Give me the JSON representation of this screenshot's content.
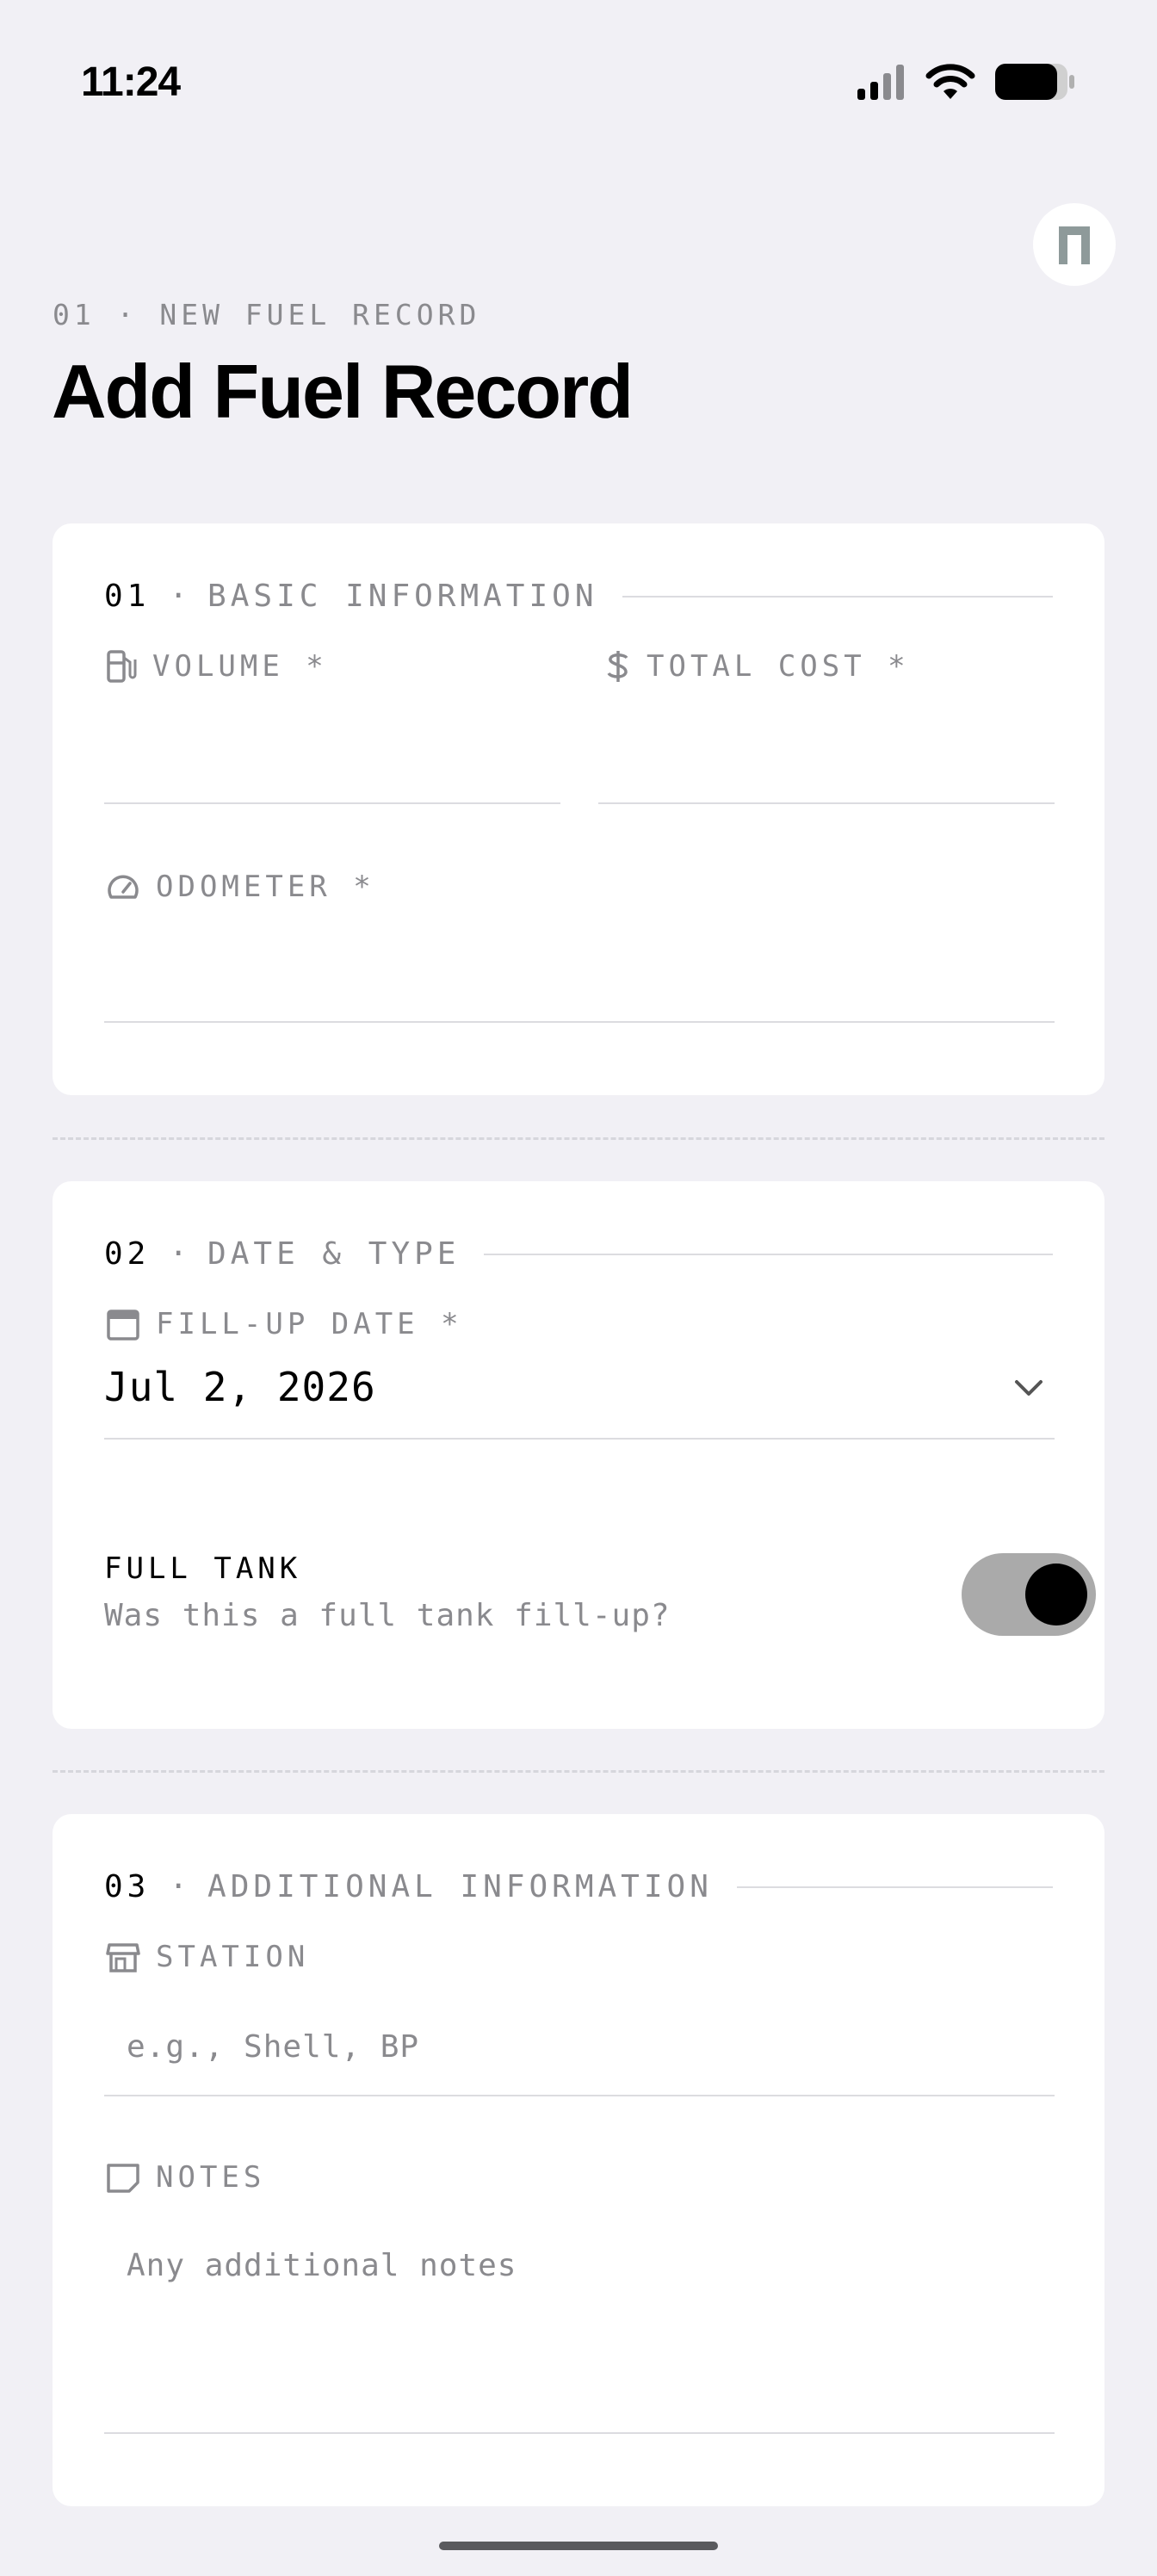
{
  "status_bar": {
    "time": "11:24"
  },
  "avatar": {
    "letter": "n"
  },
  "header": {
    "eyebrow": "01 · NEW FUEL RECORD",
    "title": "Add Fuel Record"
  },
  "section1": {
    "number": "01",
    "title": "BASIC INFORMATION",
    "volume_label": "VOLUME *",
    "total_cost_label": "TOTAL COST *",
    "odometer_label": "ODOMETER *"
  },
  "section2": {
    "number": "02",
    "title": "DATE & TYPE",
    "date_label": "FILL-UP DATE *",
    "date_value": "Jul 2, 2026",
    "full_tank_title": "FULL TANK",
    "full_tank_subtitle": "Was this a full tank fill-up?",
    "full_tank_on": true
  },
  "section3": {
    "number": "03",
    "title": "ADDITIONAL INFORMATION",
    "station_label": "STATION",
    "station_placeholder": "e.g., Shell, BP",
    "notes_label": "NOTES",
    "notes_placeholder": "Any additional notes"
  },
  "colors": {
    "background": "#f1f0f5",
    "card": "#ffffff",
    "muted_text": "#8a8a8e",
    "toggle_track": "#aaaaaa",
    "toggle_knob": "#000000"
  }
}
